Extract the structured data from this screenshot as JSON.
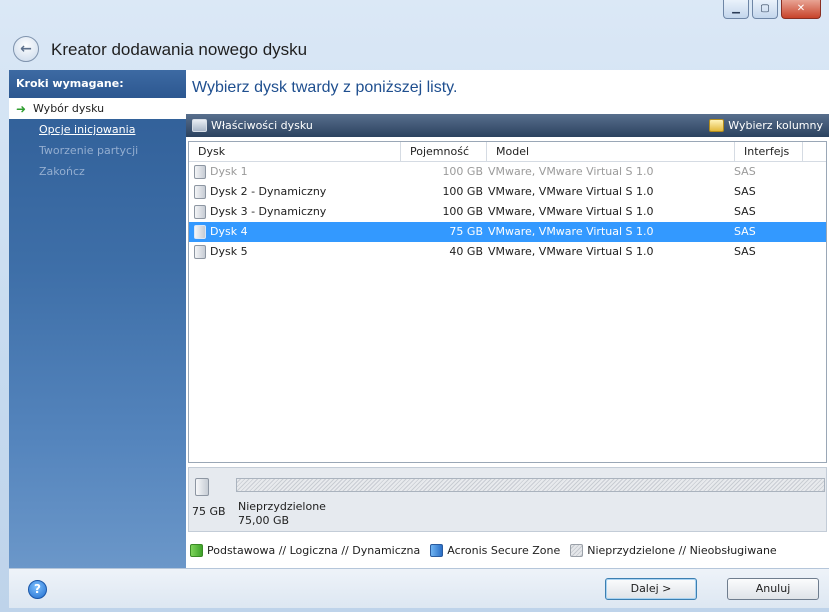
{
  "window": {
    "title": "Kreator dodawania nowego dysku",
    "minimize_glyph": "▁",
    "maximize_glyph": "▢",
    "close_glyph": "✕",
    "back_glyph": "←"
  },
  "steps": {
    "heading": "Kroki wymagane:",
    "items": [
      {
        "label": "Wybór dysku",
        "state": "current"
      },
      {
        "label": "Opcje inicjowania",
        "state": "link"
      },
      {
        "label": "Tworzenie partycji",
        "state": "disabled"
      },
      {
        "label": "Zakończ",
        "state": "disabled"
      }
    ],
    "current_icon": "green-arrow-icon",
    "arrow_glyph": "➜"
  },
  "main": {
    "heading": "Wybierz dysk twardy z poniższej listy.",
    "toolbar": {
      "properties_label": "Właściwości dysku",
      "choose_columns_label": "Wybierz kolumny"
    },
    "table": {
      "columns": [
        "Dysk",
        "Pojemność",
        "Model",
        "Interfejs"
      ],
      "rows": [
        {
          "name": "Dysk 1",
          "capacity": "100 GB",
          "model": "VMware, VMware Virtual S 1.0",
          "interface": "SAS",
          "state": "disabled"
        },
        {
          "name": "Dysk 2 - Dynamiczny",
          "capacity": "100 GB",
          "model": "VMware, VMware Virtual S 1.0",
          "interface": "SAS",
          "state": "normal"
        },
        {
          "name": "Dysk 3 - Dynamiczny",
          "capacity": "100 GB",
          "model": "VMware, VMware Virtual S 1.0",
          "interface": "SAS",
          "state": "normal"
        },
        {
          "name": "Dysk 4",
          "capacity": "75 GB",
          "model": "VMware, VMware Virtual S 1.0",
          "interface": "SAS",
          "state": "selected"
        },
        {
          "name": "Dysk 5",
          "capacity": "40 GB",
          "model": "VMware, VMware Virtual S 1.0",
          "interface": "SAS",
          "state": "normal"
        }
      ]
    },
    "disk_panel": {
      "size": "75 GB",
      "partition_label": "Nieprzydzielone",
      "partition_size": "75,00 GB"
    },
    "legend": [
      {
        "label": "Podstawowa // Logiczna // Dynamiczna",
        "color": "#4cb832"
      },
      {
        "label": "Acronis Secure Zone",
        "color": "#2f7bd6"
      },
      {
        "label": "Nieprzydzielone // Nieobsługiwane",
        "color": "#cfd3d8"
      }
    ]
  },
  "footer": {
    "help_glyph": "?",
    "next_label": "Dalej >",
    "cancel_label": "Anuluj"
  },
  "colors": {
    "selection": "#3399ff",
    "heading": "#1f4f8f",
    "steps_panel": "#2f5d96"
  }
}
